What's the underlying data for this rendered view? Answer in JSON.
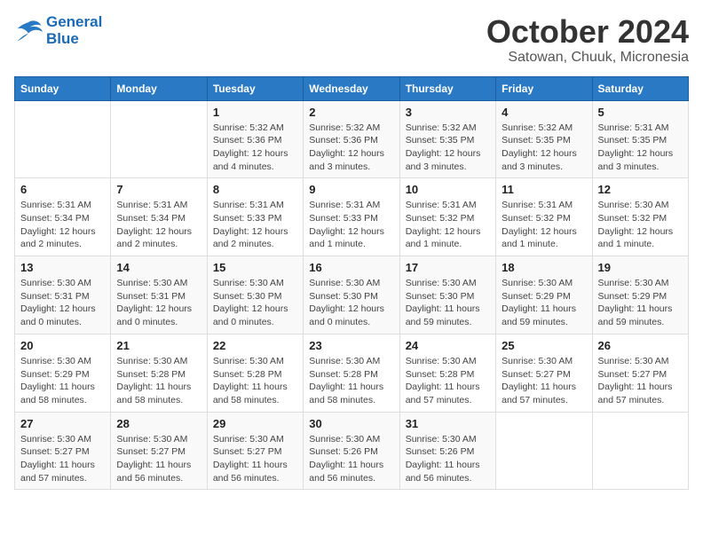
{
  "logo": {
    "line1": "General",
    "line2": "Blue"
  },
  "title": "October 2024",
  "location": "Satowan, Chuuk, Micronesia",
  "days_header": [
    "Sunday",
    "Monday",
    "Tuesday",
    "Wednesday",
    "Thursday",
    "Friday",
    "Saturday"
  ],
  "weeks": [
    [
      {
        "day": "",
        "info": ""
      },
      {
        "day": "",
        "info": ""
      },
      {
        "day": "1",
        "info": "Sunrise: 5:32 AM\nSunset: 5:36 PM\nDaylight: 12 hours and 4 minutes."
      },
      {
        "day": "2",
        "info": "Sunrise: 5:32 AM\nSunset: 5:36 PM\nDaylight: 12 hours and 3 minutes."
      },
      {
        "day": "3",
        "info": "Sunrise: 5:32 AM\nSunset: 5:35 PM\nDaylight: 12 hours and 3 minutes."
      },
      {
        "day": "4",
        "info": "Sunrise: 5:32 AM\nSunset: 5:35 PM\nDaylight: 12 hours and 3 minutes."
      },
      {
        "day": "5",
        "info": "Sunrise: 5:31 AM\nSunset: 5:35 PM\nDaylight: 12 hours and 3 minutes."
      }
    ],
    [
      {
        "day": "6",
        "info": "Sunrise: 5:31 AM\nSunset: 5:34 PM\nDaylight: 12 hours and 2 minutes."
      },
      {
        "day": "7",
        "info": "Sunrise: 5:31 AM\nSunset: 5:34 PM\nDaylight: 12 hours and 2 minutes."
      },
      {
        "day": "8",
        "info": "Sunrise: 5:31 AM\nSunset: 5:33 PM\nDaylight: 12 hours and 2 minutes."
      },
      {
        "day": "9",
        "info": "Sunrise: 5:31 AM\nSunset: 5:33 PM\nDaylight: 12 hours and 1 minute."
      },
      {
        "day": "10",
        "info": "Sunrise: 5:31 AM\nSunset: 5:32 PM\nDaylight: 12 hours and 1 minute."
      },
      {
        "day": "11",
        "info": "Sunrise: 5:31 AM\nSunset: 5:32 PM\nDaylight: 12 hours and 1 minute."
      },
      {
        "day": "12",
        "info": "Sunrise: 5:30 AM\nSunset: 5:32 PM\nDaylight: 12 hours and 1 minute."
      }
    ],
    [
      {
        "day": "13",
        "info": "Sunrise: 5:30 AM\nSunset: 5:31 PM\nDaylight: 12 hours and 0 minutes."
      },
      {
        "day": "14",
        "info": "Sunrise: 5:30 AM\nSunset: 5:31 PM\nDaylight: 12 hours and 0 minutes."
      },
      {
        "day": "15",
        "info": "Sunrise: 5:30 AM\nSunset: 5:30 PM\nDaylight: 12 hours and 0 minutes."
      },
      {
        "day": "16",
        "info": "Sunrise: 5:30 AM\nSunset: 5:30 PM\nDaylight: 12 hours and 0 minutes."
      },
      {
        "day": "17",
        "info": "Sunrise: 5:30 AM\nSunset: 5:30 PM\nDaylight: 11 hours and 59 minutes."
      },
      {
        "day": "18",
        "info": "Sunrise: 5:30 AM\nSunset: 5:29 PM\nDaylight: 11 hours and 59 minutes."
      },
      {
        "day": "19",
        "info": "Sunrise: 5:30 AM\nSunset: 5:29 PM\nDaylight: 11 hours and 59 minutes."
      }
    ],
    [
      {
        "day": "20",
        "info": "Sunrise: 5:30 AM\nSunset: 5:29 PM\nDaylight: 11 hours and 58 minutes."
      },
      {
        "day": "21",
        "info": "Sunrise: 5:30 AM\nSunset: 5:28 PM\nDaylight: 11 hours and 58 minutes."
      },
      {
        "day": "22",
        "info": "Sunrise: 5:30 AM\nSunset: 5:28 PM\nDaylight: 11 hours and 58 minutes."
      },
      {
        "day": "23",
        "info": "Sunrise: 5:30 AM\nSunset: 5:28 PM\nDaylight: 11 hours and 58 minutes."
      },
      {
        "day": "24",
        "info": "Sunrise: 5:30 AM\nSunset: 5:28 PM\nDaylight: 11 hours and 57 minutes."
      },
      {
        "day": "25",
        "info": "Sunrise: 5:30 AM\nSunset: 5:27 PM\nDaylight: 11 hours and 57 minutes."
      },
      {
        "day": "26",
        "info": "Sunrise: 5:30 AM\nSunset: 5:27 PM\nDaylight: 11 hours and 57 minutes."
      }
    ],
    [
      {
        "day": "27",
        "info": "Sunrise: 5:30 AM\nSunset: 5:27 PM\nDaylight: 11 hours and 57 minutes."
      },
      {
        "day": "28",
        "info": "Sunrise: 5:30 AM\nSunset: 5:27 PM\nDaylight: 11 hours and 56 minutes."
      },
      {
        "day": "29",
        "info": "Sunrise: 5:30 AM\nSunset: 5:27 PM\nDaylight: 11 hours and 56 minutes."
      },
      {
        "day": "30",
        "info": "Sunrise: 5:30 AM\nSunset: 5:26 PM\nDaylight: 11 hours and 56 minutes."
      },
      {
        "day": "31",
        "info": "Sunrise: 5:30 AM\nSunset: 5:26 PM\nDaylight: 11 hours and 56 minutes."
      },
      {
        "day": "",
        "info": ""
      },
      {
        "day": "",
        "info": ""
      }
    ]
  ]
}
